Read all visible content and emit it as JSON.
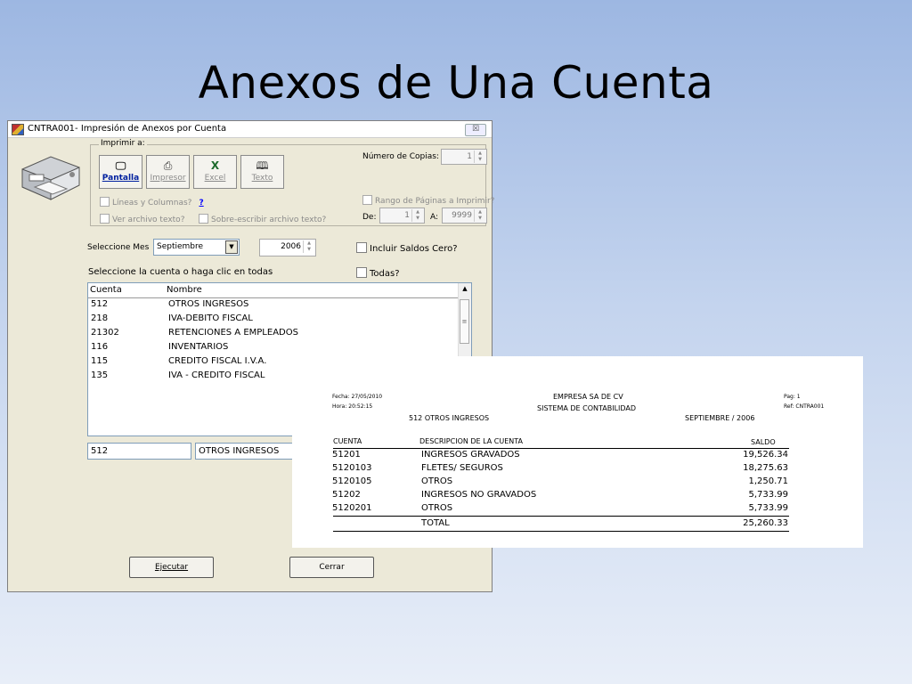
{
  "slide": {
    "title": "Anexos de Una Cuenta"
  },
  "window": {
    "title": "CNTRA001- Impresión de Anexos por Cuenta",
    "close_glyph": "☒",
    "print_group": {
      "label": "Imprimir a:",
      "buttons": [
        {
          "label": "Pantalla",
          "icon": "monitor-icon"
        },
        {
          "label": "Impresor",
          "icon": "printer-icon"
        },
        {
          "label": "Excel",
          "icon": "excel-icon"
        },
        {
          "label": "Texto",
          "icon": "book-icon"
        }
      ],
      "lineas_columnas": "Líneas y Columnas?",
      "help": "?",
      "ver_archivo": "Ver archivo texto?",
      "sobre_escribir": "Sobre-escribir archivo texto?",
      "copias_label": "Número de Copias:",
      "copias_value": "1",
      "rango_label": "Rango de Páginas a Imprimir?",
      "de_label": "De:",
      "de_value": "1",
      "a_label": "A:",
      "a_value": "9999"
    },
    "mes_label": "Seleccione Mes",
    "mes_value": "Septiembre",
    "year_value": "2006",
    "incluir_saldos": "Incluir Saldos Cero?",
    "seleccione_cuenta": "Seleccione la cuenta o haga clic en todas",
    "todas": "Todas?",
    "list": {
      "headers": [
        "Cuenta",
        "Nombre"
      ],
      "rows": [
        {
          "cuenta": "512",
          "nombre": "OTROS INGRESOS"
        },
        {
          "cuenta": "218",
          "nombre": "IVA-DEBITO FISCAL"
        },
        {
          "cuenta": "21302",
          "nombre": "RETENCIONES A EMPLEADOS"
        },
        {
          "cuenta": "116",
          "nombre": "INVENTARIOS"
        },
        {
          "cuenta": "115",
          "nombre": "CREDITO FISCAL I.V.A."
        },
        {
          "cuenta": "135",
          "nombre": "IVA - CREDITO FISCAL"
        }
      ]
    },
    "selected_cuenta": "512",
    "selected_nombre": "OTROS INGRESOS",
    "ejecutar": "Ejecutar",
    "cerrar": "Cerrar"
  },
  "report": {
    "fecha": "Fecha:  27/05/2010",
    "hora": "Hora:   20:52:15",
    "empresa": "EMPRESA SA DE CV",
    "sistema": "SISTEMA DE CONTABILIDAD",
    "pag": "Pag:     1",
    "ref": "Ref:  CNTRA001",
    "cuenta_titulo": "512 OTROS INGRESOS",
    "periodo": "SEPTIEMBRE / 2006",
    "headers": {
      "cuenta": "CUENTA",
      "descripcion": "DESCRIPCION DE LA CUENTA",
      "saldo": "SALDO"
    },
    "rows": [
      {
        "cuenta": "51201",
        "descripcion": "INGRESOS GRAVADOS",
        "saldo": "19,526.34"
      },
      {
        "cuenta": "5120103",
        "descripcion": "FLETES/ SEGUROS",
        "saldo": "18,275.63"
      },
      {
        "cuenta": "5120105",
        "descripcion": "OTROS",
        "saldo": "1,250.71"
      },
      {
        "cuenta": "51202",
        "descripcion": "INGRESOS NO GRAVADOS",
        "saldo": "5,733.99"
      },
      {
        "cuenta": "5120201",
        "descripcion": "OTROS",
        "saldo": "5,733.99"
      }
    ],
    "total_label": "TOTAL",
    "total_value": "25,260.33"
  }
}
